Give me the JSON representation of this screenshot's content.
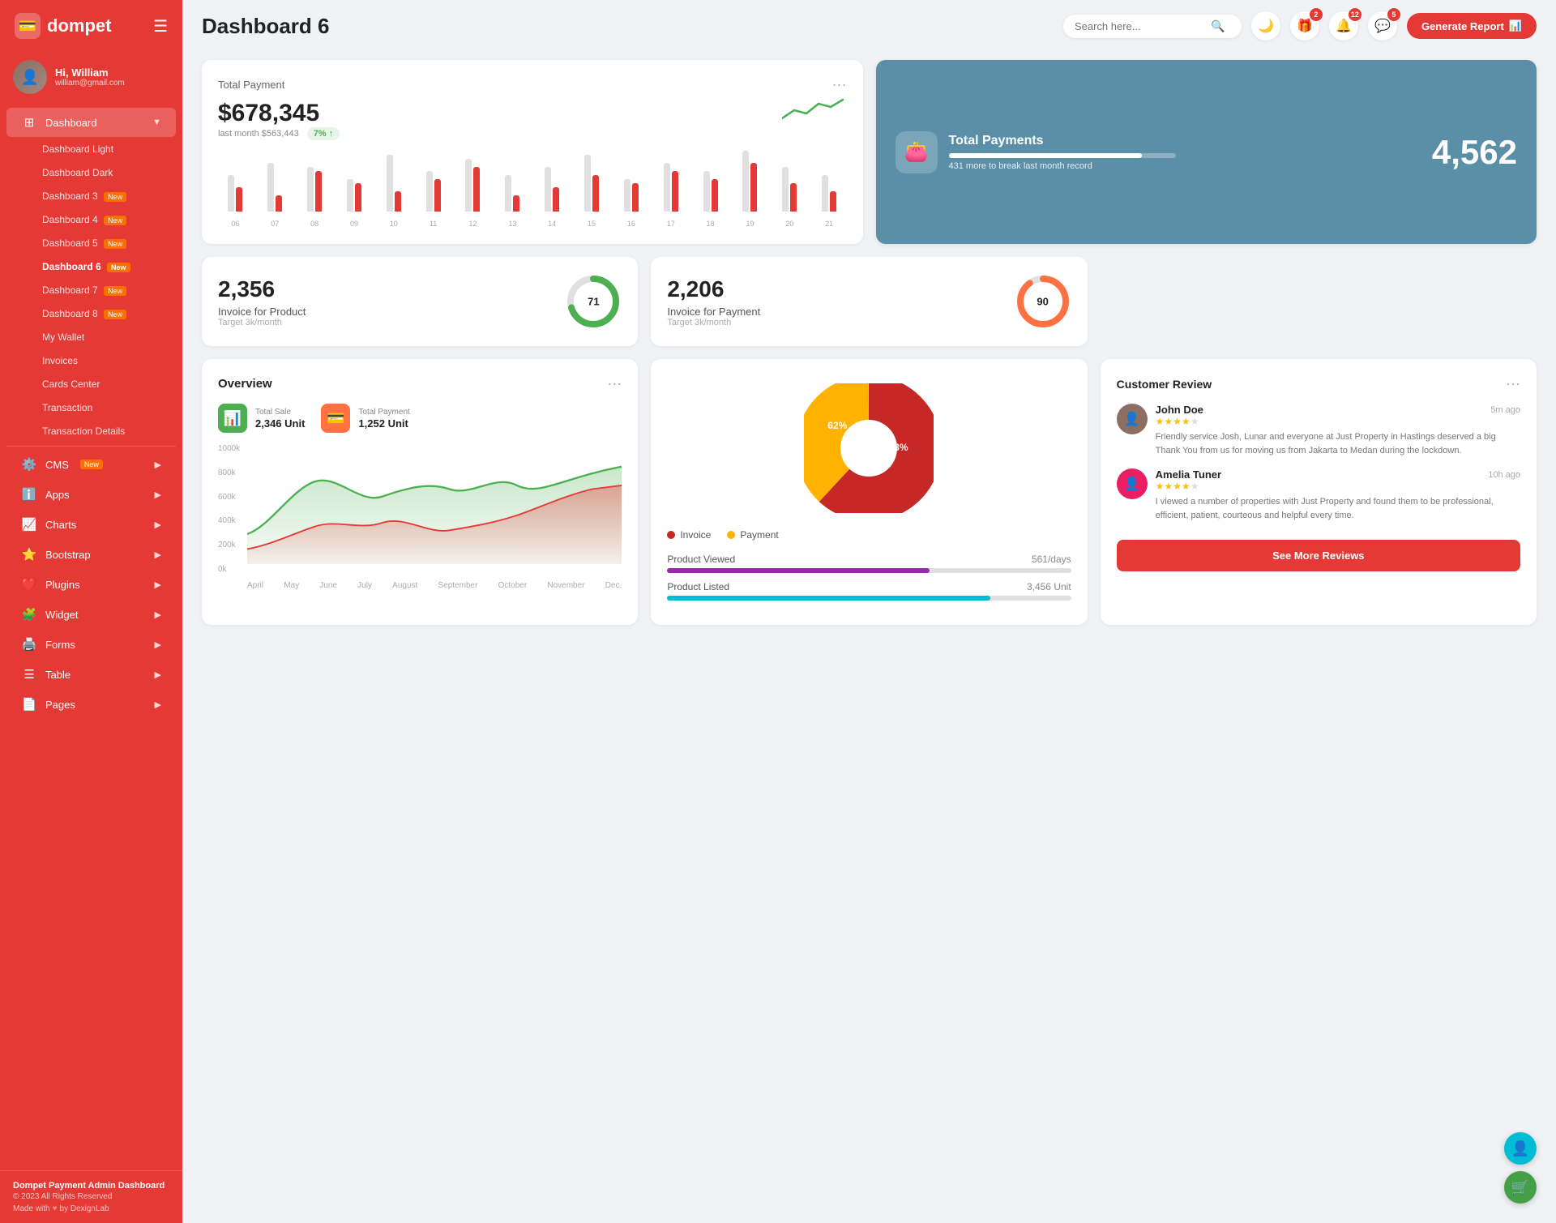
{
  "app": {
    "name": "dompet",
    "logo_icon": "💳"
  },
  "user": {
    "greeting": "Hi, William",
    "name": "William",
    "email": "william@gmail.com",
    "avatar_initial": "W"
  },
  "header": {
    "title": "Dashboard 6",
    "search_placeholder": "Search here...",
    "generate_btn": "Generate Report"
  },
  "header_icons": {
    "theme_icon": "🌙",
    "gift_badge": "2",
    "bell_badge": "12",
    "chat_badge": "5"
  },
  "sidebar": {
    "dashboard_label": "Dashboard",
    "items": [
      {
        "id": "dashboard-light",
        "label": "Dashboard Light",
        "badge": ""
      },
      {
        "id": "dashboard-dark",
        "label": "Dashboard Dark",
        "badge": ""
      },
      {
        "id": "dashboard-3",
        "label": "Dashboard 3",
        "badge": "New"
      },
      {
        "id": "dashboard-4",
        "label": "Dashboard 4",
        "badge": "New"
      },
      {
        "id": "dashboard-5",
        "label": "Dashboard 5",
        "badge": "New"
      },
      {
        "id": "dashboard-6",
        "label": "Dashboard 6",
        "badge": "New"
      },
      {
        "id": "dashboard-7",
        "label": "Dashboard 7",
        "badge": "New"
      },
      {
        "id": "dashboard-8",
        "label": "Dashboard 8",
        "badge": "New"
      },
      {
        "id": "my-wallet",
        "label": "My Wallet",
        "badge": ""
      },
      {
        "id": "invoices",
        "label": "Invoices",
        "badge": ""
      },
      {
        "id": "cards-center",
        "label": "Cards Center",
        "badge": ""
      },
      {
        "id": "transaction",
        "label": "Transaction",
        "badge": ""
      },
      {
        "id": "transaction-details",
        "label": "Transaction Details",
        "badge": ""
      }
    ],
    "sections": [
      {
        "id": "cms",
        "label": "CMS",
        "icon": "⚙️",
        "badge": "New",
        "has_arrow": true
      },
      {
        "id": "apps",
        "label": "Apps",
        "icon": "ℹ️",
        "has_arrow": true
      },
      {
        "id": "charts",
        "label": "Charts",
        "icon": "📈",
        "has_arrow": true
      },
      {
        "id": "bootstrap",
        "label": "Bootstrap",
        "icon": "⭐",
        "has_arrow": true
      },
      {
        "id": "plugins",
        "label": "Plugins",
        "icon": "❤️",
        "has_arrow": true
      },
      {
        "id": "widget",
        "label": "Widget",
        "icon": "🧩",
        "has_arrow": true
      },
      {
        "id": "forms",
        "label": "Forms",
        "icon": "🖨️",
        "has_arrow": true
      },
      {
        "id": "table",
        "label": "Table",
        "icon": "☰",
        "has_arrow": true
      },
      {
        "id": "pages",
        "label": "Pages",
        "icon": "📄",
        "has_arrow": true
      }
    ],
    "footer": {
      "brand": "Dompet Payment Admin Dashboard",
      "copyright": "© 2023 All Rights Reserved",
      "made_with": "Made with",
      "by": "by DexignLab"
    }
  },
  "total_payment": {
    "title": "Total Payment",
    "amount": "$678,345",
    "last_month": "last month $563,443",
    "trend_percent": "7%",
    "bars": [
      {
        "gray": 45,
        "red": 30
      },
      {
        "gray": 60,
        "red": 20
      },
      {
        "gray": 55,
        "red": 50
      },
      {
        "gray": 40,
        "red": 35
      },
      {
        "gray": 70,
        "red": 25
      },
      {
        "gray": 50,
        "red": 40
      },
      {
        "gray": 65,
        "red": 55
      },
      {
        "gray": 45,
        "red": 20
      },
      {
        "gray": 55,
        "red": 30
      },
      {
        "gray": 70,
        "red": 45
      },
      {
        "gray": 40,
        "red": 35
      },
      {
        "gray": 60,
        "red": 50
      },
      {
        "gray": 50,
        "red": 40
      },
      {
        "gray": 75,
        "red": 60
      },
      {
        "gray": 55,
        "red": 35
      },
      {
        "gray": 45,
        "red": 25
      }
    ],
    "bar_labels": [
      "06",
      "07",
      "08",
      "09",
      "10",
      "11",
      "12",
      "13",
      "14",
      "15",
      "16",
      "17",
      "18",
      "19",
      "20",
      "21"
    ]
  },
  "total_payments_card": {
    "title": "Total Payments",
    "number": "4,562",
    "sub": "431 more to break last month record",
    "progress": 85
  },
  "invoice_product": {
    "number": "2,356",
    "label": "Invoice for Product",
    "target": "Target 3k/month",
    "percent": 71,
    "color": "#4caf50"
  },
  "invoice_payment": {
    "number": "2,206",
    "label": "Invoice for Payment",
    "target": "Target 3k/month",
    "percent": 90,
    "color": "#ff7043"
  },
  "overview": {
    "title": "Overview",
    "total_sale_label": "Total Sale",
    "total_sale_value": "2,346 Unit",
    "total_payment_label": "Total Payment",
    "total_payment_value": "1,252 Unit",
    "months": [
      "April",
      "May",
      "June",
      "July",
      "August",
      "September",
      "October",
      "November",
      "Dec."
    ],
    "y_labels": [
      "1000k",
      "800k",
      "600k",
      "400k",
      "200k",
      "0k"
    ]
  },
  "pie_chart": {
    "invoice_pct": 62,
    "payment_pct": 38,
    "invoice_label": "62%",
    "payment_label": "38%",
    "legend_invoice": "Invoice",
    "legend_payment": "Payment",
    "invoice_color": "#c62828",
    "payment_color": "#ffb300"
  },
  "product_metrics": {
    "viewed_label": "Product Viewed",
    "viewed_value": "561/days",
    "viewed_color": "#9c27b0",
    "viewed_pct": 65,
    "listed_label": "Product Listed",
    "listed_value": "3,456 Unit",
    "listed_color": "#00bcd4",
    "listed_pct": 80
  },
  "reviews": {
    "title": "Customer Review",
    "see_more": "See More Reviews",
    "items": [
      {
        "name": "John Doe",
        "time": "5m ago",
        "stars": 4,
        "text": "Friendly service Josh, Lunar and everyone at Just Property in Hastings deserved a big Thank You from us for moving us from Jakarta to Medan during the lockdown.",
        "avatar_color": "#8d6e63"
      },
      {
        "name": "Amelia Tuner",
        "time": "10h ago",
        "stars": 4,
        "text": "I viewed a number of properties with Just Property and found them to be professional, efficient, patient, courteous and helpful every time.",
        "avatar_color": "#e91e63"
      }
    ]
  },
  "floating": {
    "support_icon": "👤",
    "cart_icon": "🛒"
  }
}
